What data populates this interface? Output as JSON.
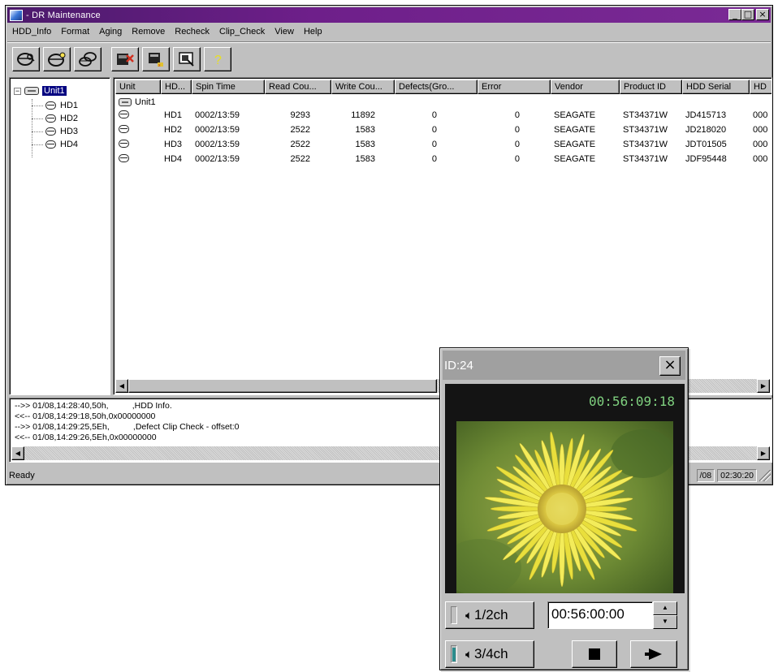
{
  "main_window": {
    "title": "-   DR Maintenance",
    "buttons": {
      "minimize": "_",
      "maximize": "□",
      "close": "×"
    }
  },
  "menu": [
    "HDD_Info",
    "Format",
    "Aging",
    "Remove",
    "Recheck",
    "Clip_Check",
    "View",
    "Help"
  ],
  "toolbar_icons": [
    "drive-search-icon",
    "drive-info-icon",
    "drive-group-icon",
    "clip-defect-icon",
    "film-defect-icon",
    "monitor-check-icon",
    "help-icon"
  ],
  "tree": {
    "root": {
      "label": "Unit1",
      "expander": "−"
    },
    "children": [
      "HD1",
      "HD2",
      "HD3",
      "HD4"
    ]
  },
  "table": {
    "headers": [
      "Unit",
      "HD...",
      "Spin Time",
      "Read Cou...",
      "Write Cou...",
      "Defects(Gro...",
      "Error",
      "Vendor",
      "Product ID",
      "HDD Serial",
      "HD"
    ],
    "unit_row": "Unit1",
    "rows": [
      {
        "hd": "HD1",
        "spin": "0002/13:59",
        "read": "9293",
        "write": "11892",
        "defects": "0",
        "error": "0",
        "vendor": "SEAGATE",
        "product": "ST34371W",
        "serial": "JD415713",
        "extra": "000"
      },
      {
        "hd": "HD2",
        "spin": "0002/13:59",
        "read": "2522",
        "write": "1583",
        "defects": "0",
        "error": "0",
        "vendor": "SEAGATE",
        "product": "ST34371W",
        "serial": "JD218020",
        "extra": "000"
      },
      {
        "hd": "HD3",
        "spin": "0002/13:59",
        "read": "2522",
        "write": "1583",
        "defects": "0",
        "error": "0",
        "vendor": "SEAGATE",
        "product": "ST34371W",
        "serial": "JDT01505",
        "extra": "000"
      },
      {
        "hd": "HD4",
        "spin": "0002/13:59",
        "read": "2522",
        "write": "1583",
        "defects": "0",
        "error": "0",
        "vendor": "SEAGATE",
        "product": "ST34371W",
        "serial": "JDF95448",
        "extra": "000"
      }
    ]
  },
  "log": [
    "-->> 01/08,14:28:40,50h,          ,HDD Info.",
    "<<-- 01/08,14:29:18,50h,0x00000000",
    "-->> 01/08,14:29:25,5Eh,          ,Defect Clip Check - offset:0",
    "<<-- 01/08,14:29:26,5Eh,0x00000000"
  ],
  "status": {
    "text": "Ready",
    "date": "/08",
    "time": "02:30:20"
  },
  "preview": {
    "title": "ID:24",
    "close": "×",
    "timecode": "00:56:09:18",
    "ch1_label": "1/2ch",
    "ch2_label": "3/4ch",
    "ch1_level": 0.0,
    "ch2_level": 0.85,
    "timecode_input": "00:56:00:00",
    "buttons": [
      "stop-icon",
      "play-icon"
    ]
  },
  "colors": {
    "titlebar": "#5a1a7a",
    "selection": "#000080",
    "timecode": "#7fd07f",
    "meter_fill": "#2c8c8c"
  }
}
